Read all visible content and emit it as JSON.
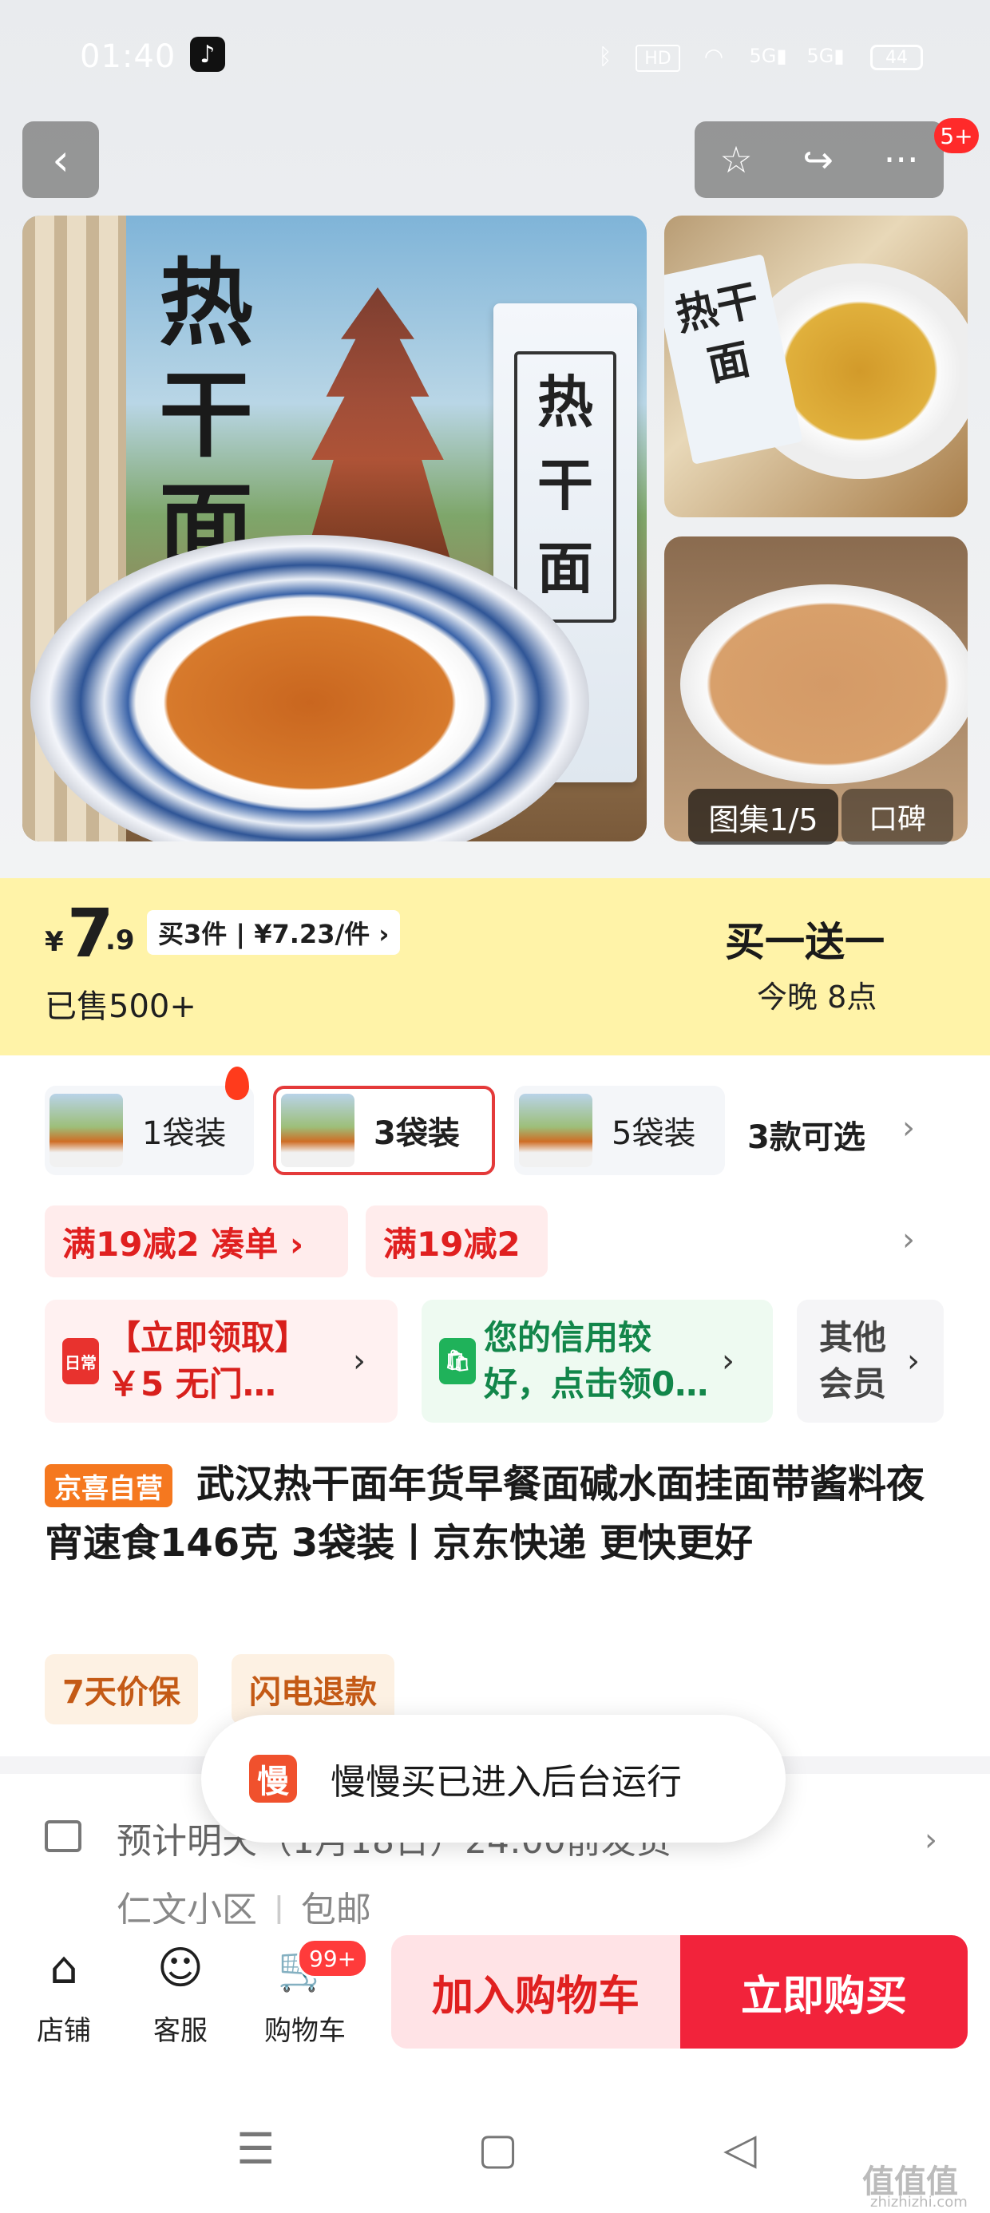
{
  "status_bar": {
    "time": "01:40",
    "app_icon": "tiktok-icon",
    "icons": [
      "bluetooth-icon",
      "hd-icon",
      "wifi-icon",
      "5g-signal-icon",
      "5g-signal-icon"
    ],
    "battery": "44"
  },
  "top_actions": {
    "back": "‹",
    "favorite": "☆",
    "share": "↪",
    "more": "···",
    "more_badge": "5+"
  },
  "gallery": {
    "main_title": "热干面",
    "pack_title": "热干面",
    "side_pack_title": "热干面",
    "counter": "图集1/5",
    "koubei": "口碑"
  },
  "price": {
    "currency": "¥",
    "integer": "7",
    "decimal": ".9",
    "multi_buy": "买3件 | ¥7.23/件 ›",
    "sold": "已售500+",
    "promo_title": "买一送一",
    "promo_time": "今晚 8点"
  },
  "variants": {
    "items": [
      {
        "label": "1袋装",
        "selected": false
      },
      {
        "label": "3袋装",
        "selected": true
      },
      {
        "label": "5袋装",
        "selected": false
      }
    ],
    "options": "3款可选",
    "chevron": "›"
  },
  "coupons": {
    "tag1": "满19减2  凑单 ›",
    "tag2": "满19减2",
    "chevron": "›",
    "card1": {
      "icon": "日常",
      "text": "【立即领取】￥5 无门…",
      "chevron": "›"
    },
    "card2": {
      "icon": "🛍",
      "text": "您的信用较好，点击领0…",
      "chevron": "›"
    },
    "card3": {
      "text": "其他会员",
      "chevron": "›"
    }
  },
  "product": {
    "tag": "京喜自营",
    "title": "武汉热干面年货早餐面碱水面挂面带酱料夜宵速食146克 3袋装丨京东快递 更快更好",
    "services": [
      "7天价保",
      "闪电退款"
    ]
  },
  "delivery": {
    "text": "预计明天（1月18日）24:00前发货",
    "address": "仁文小区",
    "shipping": "包邮",
    "chevron": "›"
  },
  "toast": {
    "logo": "慢",
    "message": "慢慢买已进入后台运行"
  },
  "bottom_bar": {
    "store": "店铺",
    "service": "客服",
    "cart": "购物车",
    "cart_badge": "99+",
    "add_to_cart": "加入购物车",
    "buy_now": "立即购买"
  },
  "system_nav": {
    "menu": "☰",
    "home": "▢",
    "back": "◁"
  },
  "watermark": {
    "main": "值值值",
    "sub": "zhizhizhi.com"
  },
  "colors": {
    "accent_red": "#f2233b",
    "price_yellow": "#ffd61e",
    "tag_orange": "#f5781f",
    "green": "#12864a"
  }
}
